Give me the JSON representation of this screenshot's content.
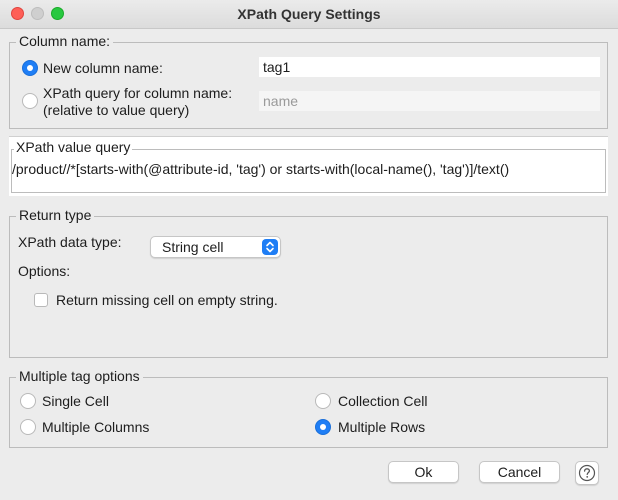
{
  "window": {
    "title": "XPath Query Settings"
  },
  "column_name": {
    "legend": "Column name:",
    "new_column_label": "New column name:",
    "new_column_value": "tag1",
    "xpath_column_label_line1": "XPath query for column name:",
    "xpath_column_label_line2": "(relative to value query)",
    "xpath_column_placeholder": "name"
  },
  "value_query": {
    "legend": "XPath value query",
    "value": "/product//*[starts-with(@attribute-id, 'tag') or starts-with(local-name(), 'tag')]/text()"
  },
  "return_type": {
    "legend": "Return type",
    "data_type_label": "XPath data type:",
    "data_type_value": "String cell",
    "options_label": "Options:",
    "missing_cell_label": "Return missing cell on empty string."
  },
  "multiple_tag": {
    "legend": "Multiple tag options",
    "single_cell": "Single Cell",
    "collection_cell": "Collection Cell",
    "multiple_columns": "Multiple Columns",
    "multiple_rows": "Multiple Rows",
    "selected": "Multiple Rows"
  },
  "buttons": {
    "ok": "Ok",
    "cancel": "Cancel"
  },
  "icons": {
    "close": "close-window-icon",
    "minimize": "minimize-window-icon",
    "maximize": "maximize-window-icon",
    "select_arrows": "up-down-chevron-icon",
    "help": "question-mark-icon"
  },
  "colors": {
    "accent": "#1f7ef5",
    "window_bg": "#ececec",
    "close": "#fe5f57",
    "maximize": "#28c840"
  }
}
